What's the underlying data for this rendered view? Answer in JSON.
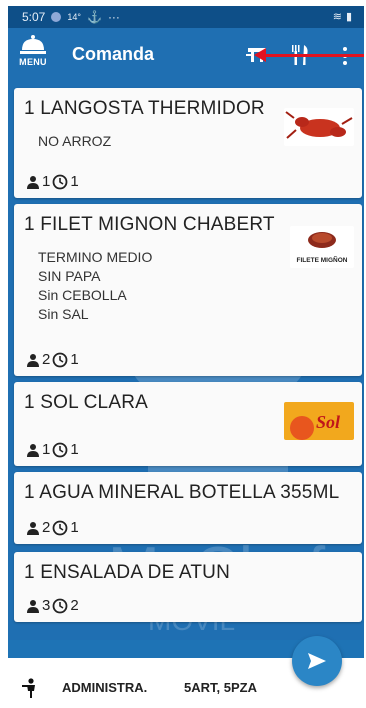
{
  "status_bar": {
    "time": "5:07",
    "extra": "14°"
  },
  "app_bar": {
    "menu_label": "MENU",
    "title": "Comanda"
  },
  "orders": [
    {
      "name": "1 LANGOSTA THERMIDOR",
      "notes": [
        "NO ARROZ"
      ],
      "diners": "1",
      "time": "1",
      "image": "lobster"
    },
    {
      "name": "1 FILET MIGNON CHABERT",
      "notes": [
        "TERMINO MEDIO",
        "SIN PAPA",
        "Sin CEBOLLA",
        "Sin SAL"
      ],
      "diners": "2",
      "time": "1",
      "image": "filete",
      "image_caption": "FILETE MIGÑON"
    },
    {
      "name": "1 SOL CLARA",
      "notes": [],
      "diners": "1",
      "time": "1",
      "image": "beer",
      "image_caption": "Sol"
    },
    {
      "name": "1 AGUA MINERAL BOTELLA 355ML",
      "notes": [],
      "diners": "2",
      "time": "1"
    },
    {
      "name": "1 ENSALADA DE ATUN",
      "notes": [],
      "diners": "3",
      "time": "2"
    }
  ],
  "watermark": {
    "brand": "Mr.Chef",
    "sub": "MOVIL"
  },
  "footer": {
    "user": "ADMINISTRA.",
    "summary": "5ART, 5PZA"
  },
  "colors": {
    "primary": "#1f6fb2",
    "status_bar": "#0e4f88",
    "arrow": "#e2121f",
    "fab": "#2b86c6"
  }
}
